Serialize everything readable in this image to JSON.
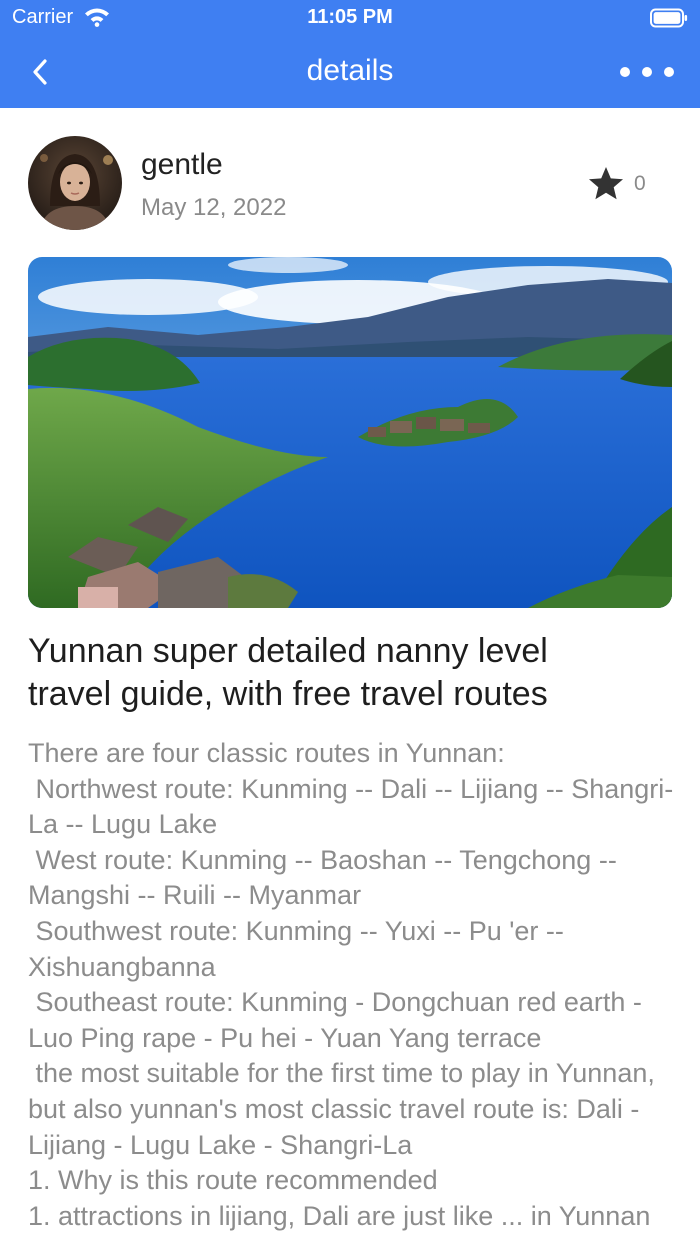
{
  "status_bar": {
    "carrier": "Carrier",
    "time": "11:05 PM",
    "wifi_icon": "wifi-icon",
    "battery_icon": "battery-icon"
  },
  "nav": {
    "title": "details",
    "back_icon": "chevron-left-icon",
    "more_icon": "more-horizontal-icon",
    "bar_color": "#3f7ff2"
  },
  "author": {
    "name": "gentle",
    "date": "May 12, 2022",
    "favorite_icon": "star-icon",
    "favorite_count": "0"
  },
  "post": {
    "image_alt": "lake with island",
    "title": "Yunnan super detailed nanny level\ntravel guide, with free travel routes",
    "body": "There are four classic routes in Yunnan:\n Northwest route: Kunming -- Dali -- Lijiang -- Shangri-La -- Lugu Lake\n West route: Kunming -- Baoshan -- Tengchong -- Mangshi -- Ruili -- Myanmar\n Southwest route: Kunming -- Yuxi -- Pu 'er -- Xishuangbanna\n Southeast route: Kunming - Dongchuan red earth - Luo Ping rape - Pu hei - Yuan Yang terrace\n the most suitable for the first time to play in Yunnan, but also yunnan's most classic travel route is: Dali - Lijiang - Lugu Lake - Shangri-La\n1. Why is this route recommended\n1. attractions in lijiang, Dali are just like ... in Yunnan"
  }
}
